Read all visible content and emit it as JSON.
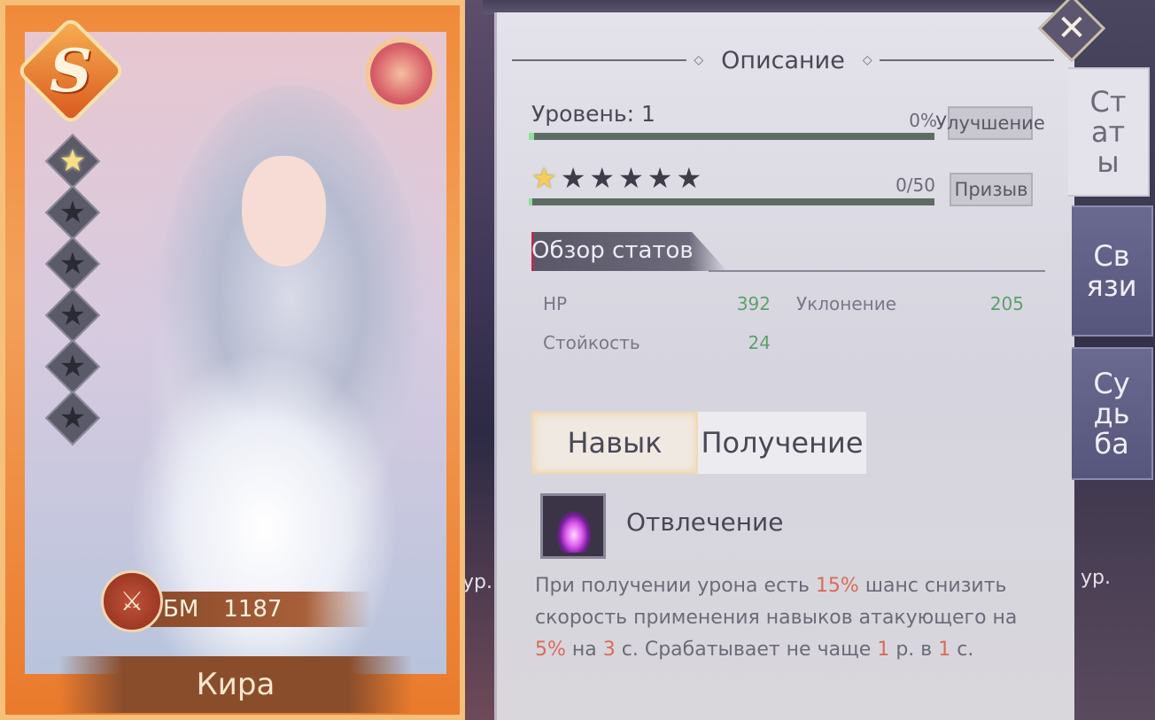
{
  "card": {
    "rank": "S",
    "stars_filled": 1,
    "stars_total": 6,
    "power_label": "БМ",
    "power_value": "1187",
    "name": "Кира"
  },
  "background": {
    "level_left": "ур.",
    "level_right": "ур."
  },
  "panel": {
    "title": "Описание",
    "level_label": "Уровень: 1",
    "level_percent": "0%",
    "level_progress": 0.01,
    "upgrade_button": "Улучшение",
    "shards_value": "0/50",
    "shards_progress": 0.0,
    "summon_button": "Призыв",
    "stars_filled": 1,
    "stars_total": 6,
    "overview_title": "Обзор статов",
    "stats": [
      {
        "name": "HP",
        "value": "392"
      },
      {
        "name": "Уклонение",
        "value": "205"
      },
      {
        "name": "Стойкость",
        "value": "24"
      }
    ],
    "tabs": [
      {
        "label": "Навык",
        "active": true
      },
      {
        "label": "Получение",
        "active": false
      }
    ],
    "skill": {
      "name": "Отвлечение",
      "desc_parts": [
        {
          "text": "При получении урона есть ",
          "hl": false
        },
        {
          "text": "15%",
          "hl": true
        },
        {
          "text": " шанс снизить скорость применения навыков атакующего на ",
          "hl": false
        },
        {
          "text": "5%",
          "hl": true
        },
        {
          "text": " на ",
          "hl": false
        },
        {
          "text": "3",
          "hl": true
        },
        {
          "text": " с. Срабатывает не чаще ",
          "hl": false
        },
        {
          "text": "1",
          "hl": true
        },
        {
          "text": " р. в ",
          "hl": false
        },
        {
          "text": "1",
          "hl": true
        },
        {
          "text": " с.",
          "hl": false
        }
      ]
    }
  },
  "side_tabs": [
    {
      "lines": [
        "Ст",
        "ат",
        "ы"
      ],
      "active": true
    },
    {
      "lines": [
        "Св",
        "язи"
      ],
      "active": false
    },
    {
      "lines": [
        "Су",
        "дь",
        "ба"
      ],
      "active": false
    }
  ],
  "colors": {
    "card_orange": "#f08a3a",
    "stat_value": "#5ea06a",
    "highlight": "#d86c58",
    "progress_fill": "#8fe09a"
  },
  "icons": {
    "close": "close-icon",
    "power": "crossed-swords-icon",
    "skill": "purple-burst-skill-icon"
  }
}
